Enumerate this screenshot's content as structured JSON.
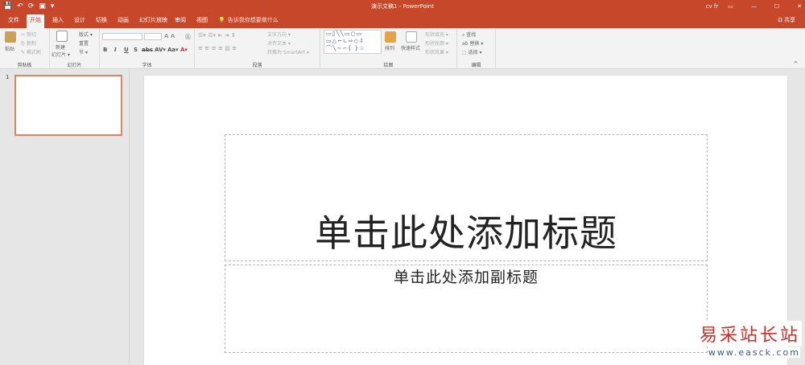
{
  "titlebar": {
    "title": "演示文稿1 - PowerPoint",
    "user": "cv fr",
    "qat": [
      "💾",
      "↶",
      "⟳",
      "▣",
      "▾"
    ],
    "restore": "▭",
    "minimize": "—",
    "maximize": "☐",
    "close": "✕"
  },
  "tabs": [
    "文件",
    "开始",
    "插入",
    "设计",
    "切换",
    "动画",
    "幻灯片放映",
    "审阅",
    "视图"
  ],
  "search": {
    "icon": "💡",
    "label": "告诉我你想要做什么"
  },
  "share": "Ω 共享",
  "ribbon": {
    "clipboard": {
      "title": "剪贴板",
      "paste": "粘贴",
      "cut": "✂ 剪切",
      "copy": "⎘ 复制",
      "painter": "✎ 格式刷"
    },
    "slides": {
      "title": "幻灯片",
      "new": "新建",
      "new2": "幻灯片 ▾",
      "layout": "版式 ▾",
      "reset": "重置",
      "section": "节 ▾"
    },
    "font": {
      "title": "字体",
      "buttons": [
        "B",
        "I",
        "U",
        "S",
        "abc",
        "AV▾",
        "Aa▾",
        "A▾"
      ]
    },
    "paragraph": {
      "title": "段落",
      "dir": "文字方向 ▾",
      "align": "对齐文本 ▾",
      "smartart": "转换为 SmartArt ▾"
    },
    "drawing": {
      "title": "绘图",
      "shapes": "▭▯╲╲▭○▭ ▭△⌐∟⇨◇⇩ ⌒╲∼∽{ }☆",
      "arrange": "排列",
      "quick": "快速样式",
      "fill": "形状填充 ▾",
      "outline": "形状轮廓 ▾",
      "effects": "形状效果 ▾"
    },
    "editing": {
      "title": "编辑",
      "find": "⌕ 查找",
      "replace": "ab 替换 ▾",
      "select": "⬚ 选择 ▾"
    }
  },
  "slides_panel": {
    "number": "1"
  },
  "slide": {
    "title_placeholder": "单击此处添加标题",
    "subtitle_placeholder": "单击此处添加副标题"
  },
  "watermark": {
    "line1": "易采站长站",
    "line2": "www.easck.com"
  }
}
